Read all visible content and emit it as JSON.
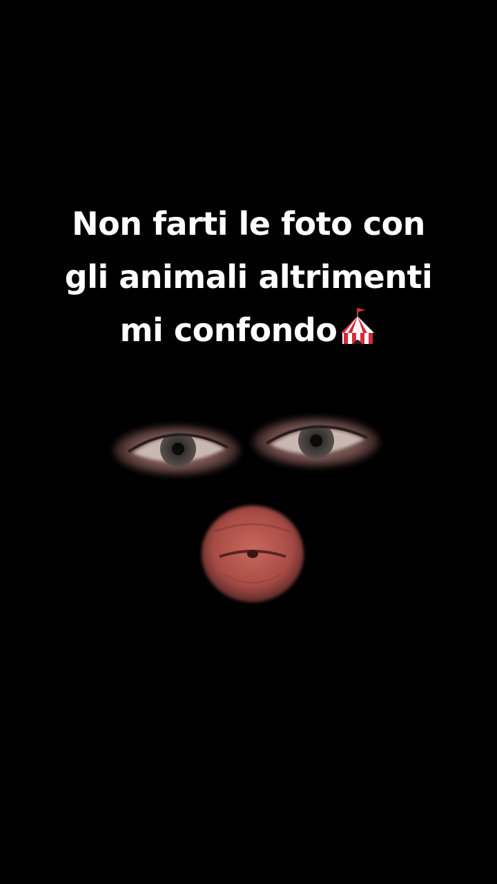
{
  "caption": {
    "line1": "Non farti le foto con",
    "line2": "gli animali altrimenti",
    "line3": "mi confondo"
  },
  "icons": {
    "caption_emoji": "circus-tent-icon"
  },
  "colors": {
    "background": "#000000",
    "text": "#ffffff",
    "tent_red": "#d8283a",
    "lips": "#b8574e"
  }
}
